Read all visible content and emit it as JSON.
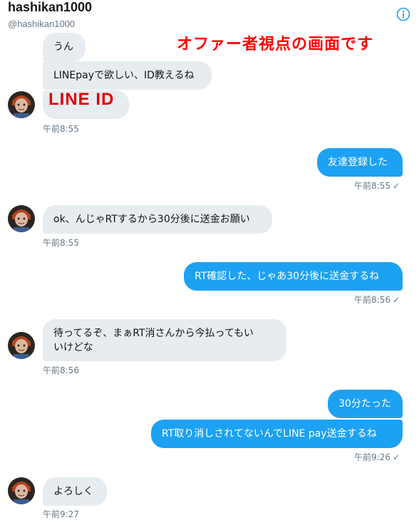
{
  "header": {
    "title": "hashikan1000",
    "handle": "@hashikan1000",
    "overlay_note": "オファー者視点の画面です"
  },
  "messages": {
    "m1": "うん",
    "m2": "LINEpayで欲しい、ID教えるね",
    "m3": "LINE ID",
    "t1": "午前8:55",
    "m4": "友達登録した",
    "t2": "午前8:55",
    "m5": "ok、んじゃRTするから30分後に送金お願い",
    "t3": "午前8:55",
    "m6": "RT確認した、じゃあ30分後に送金するね",
    "t4": "午前8:56",
    "m7a": "待ってるぞ、まぁRT消さんから今払ってもい",
    "m7b": "いけどな",
    "t5": "午前8:56",
    "m8": "30分たった",
    "m9": "RT取り消しされてないんでLINE pay送金するね",
    "t6": "午前9:26",
    "m10": "よろしく",
    "t7": "午前9:27"
  },
  "icons": {
    "info": "info-icon",
    "read": "checkmark-icon",
    "avatar": "avatar-doll"
  },
  "colors": {
    "incoming_bubble": "#e6ecf0",
    "outgoing_bubble": "#1da1f2",
    "overlay_red": "#ff0000",
    "meta_gray": "#657786"
  }
}
